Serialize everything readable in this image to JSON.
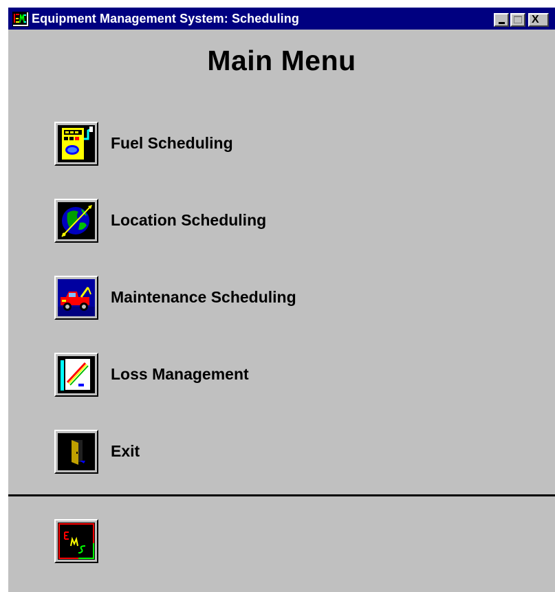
{
  "window": {
    "title": "Equipment Management System: Scheduling",
    "app_icon": "ems-app-icon",
    "controls": {
      "minimize": "minimize-icon",
      "maximize": "maximize-icon",
      "close_label": "X"
    }
  },
  "main_title": "Main Menu",
  "menu": [
    {
      "label": "Fuel Scheduling",
      "icon": "fuel-pump-icon"
    },
    {
      "label": "Location Scheduling",
      "icon": "globe-icon"
    },
    {
      "label": "Maintenance Scheduling",
      "icon": "tow-truck-icon"
    },
    {
      "label": "Loss Management",
      "icon": "chart-document-icon"
    },
    {
      "label": "Exit",
      "icon": "exit-door-icon"
    }
  ],
  "logo": {
    "icon": "ems-logo-icon"
  },
  "colors": {
    "titlebar": "#000080",
    "window_bg": "#c0c0c0",
    "divider": "#000000"
  }
}
